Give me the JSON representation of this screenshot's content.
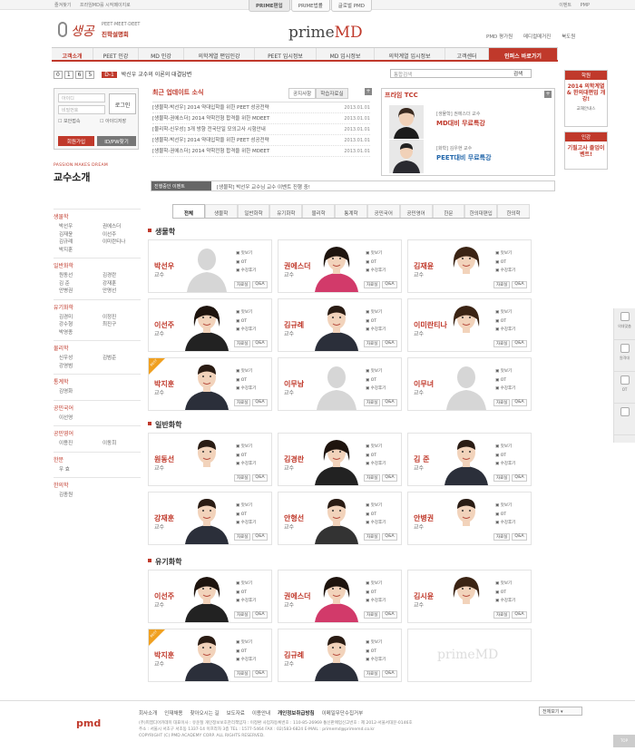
{
  "topbar": {
    "links": [
      "즐겨찾기",
      "프라임MD를 시작페이지로"
    ],
    "tabs": [
      "PRIME편입",
      "PRIME법률",
      "글로벌 PMD"
    ],
    "right": [
      "이벤트",
      "PMP"
    ]
  },
  "header": {
    "logo_left_text": "생공",
    "logo_left_sub": "PEET·MEET·DEET",
    "logo_left_sub2": "진학설명회",
    "brand_prefix": "prime",
    "brand_suffix": "MD",
    "links": [
      "PMD 평가원",
      "메디컬매거진",
      "북도원"
    ]
  },
  "nav": [
    "고객소개",
    "PEET 인강",
    "MD 인강",
    "의학계열 편입인강",
    "PEET 입시정보",
    "MD 입시정보",
    "의학계열 입시정보",
    "고객센터",
    "인퍼스 바로가기"
  ],
  "pagenav": {
    "digits": [
      "0",
      "1",
      "6",
      "5"
    ],
    "badge": "D-1",
    "text": "박신우 교수의 이론의 대결답변"
  },
  "search": {
    "placeholder": "통합검색",
    "button": "검색"
  },
  "login": {
    "id_placeholder": "아이디",
    "pw_placeholder": "비밀번호",
    "login_button": "로그인",
    "check1": "보안접속",
    "check2": "아이디저장",
    "join_button": "회원가입",
    "find_button": "ID/PW찾기"
  },
  "updates": {
    "title": "최근 업데이트 소식",
    "tab1": "공지사항",
    "tab2": "학습자료실",
    "plus": "+",
    "items": [
      {
        "text": "[생물학-박선우] 2014 약대입학을 위한 PEET 성공전략",
        "date": "2013.01.01"
      },
      {
        "text": "[생물학-권에스더] 2014 약학전형 합격을 위한 MDEET",
        "date": "2013.01.01"
      },
      {
        "text": "[물리학-신우성] 3개 방향 전국단일 모의고사 시험안내",
        "date": "2013.01.01"
      },
      {
        "text": "[생물학-박선우] 2014 약대입학을 위한 PEET 성공전략",
        "date": "2013.01.01"
      },
      {
        "text": "[생물학-권에스더] 2014 약학전형 합격을 위한 MDEET",
        "date": "2013.01.01"
      }
    ]
  },
  "tcc": {
    "title": "프라임 TCC",
    "plus": "+",
    "rows": [
      {
        "small": "[생물학] 권에스더 교수",
        "big": "MD대비 무료특강"
      },
      {
        "small": "[화학] 김우현 교수",
        "big": "PEET대비 무료특강"
      }
    ]
  },
  "ticker": {
    "label": "진행중인 이벤트",
    "text": "[생물학] 박선우 교수님 교수 이벤트 진행 중!"
  },
  "page": {
    "passion": "PASSION MAKES DREAM",
    "title": "교수소개"
  },
  "sidebar": [
    {
      "heading": "생물학",
      "items": [
        "박선우",
        "권에스더",
        "김재윤",
        "이선주",
        "김규례",
        "이미란티나",
        "박지훈",
        ""
      ]
    },
    {
      "heading": "일반화학",
      "items": [
        "원동선",
        "김경란",
        "김 준",
        "강재훈",
        "안병권",
        "안명선"
      ]
    },
    {
      "heading": "유기화학",
      "items": [
        "김경미",
        "이정진",
        "강수형",
        "최진구",
        "박영종",
        ""
      ]
    },
    {
      "heading": "물리학",
      "items": [
        "신우성",
        "김범준",
        "강영범",
        ""
      ]
    },
    {
      "heading": "통계학",
      "items": [
        "김영화",
        ""
      ]
    },
    {
      "heading": "공민국어",
      "items": [
        "이선영",
        ""
      ]
    },
    {
      "heading": "공민영어",
      "items": [
        "이용진",
        "이동희"
      ]
    },
    {
      "heading": "한문",
      "items": [
        "우 효",
        ""
      ]
    },
    {
      "heading": "한의학",
      "items": [
        "김종원",
        ""
      ]
    }
  ],
  "subtabs": [
    "전체",
    "생물학",
    "일반화학",
    "유기화학",
    "물리학",
    "통계학",
    "공민국어",
    "공민영어",
    "한문",
    "한의대편입",
    "한의학"
  ],
  "card_links": [
    "맛보기",
    "OT",
    "수강후기"
  ],
  "card_buttons": [
    "자료실",
    "Q&A"
  ],
  "ribbon_text": "BEST",
  "logo_card": {
    "prefix": "prime",
    "suffix": "MD"
  },
  "sections": [
    {
      "heading": "생물학",
      "cards": [
        {
          "name": "박선우",
          "role": "교수",
          "photo": "silhouette",
          "ribbon": false
        },
        {
          "name": "권에스더",
          "role": "교수",
          "photo": "woman",
          "ribbon": false
        },
        {
          "name": "김재윤",
          "role": "교수",
          "photo": "woman2",
          "ribbon": false
        },
        {
          "name": "이선주",
          "role": "교수",
          "photo": "woman3",
          "ribbon": false
        },
        {
          "name": "김규례",
          "role": "교수",
          "photo": "man",
          "ribbon": false
        },
        {
          "name": "이미란티나",
          "role": "교수",
          "photo": "woman2",
          "ribbon": false
        },
        {
          "name": "박지훈",
          "role": "교수",
          "photo": "man2",
          "ribbon": true
        },
        {
          "name": "이무남",
          "role": "교수",
          "photo": "silhouette",
          "ribbon": false
        },
        {
          "name": "이무녀",
          "role": "교수",
          "photo": "silhouette",
          "ribbon": false
        }
      ]
    },
    {
      "heading": "일반화학",
      "cards": [
        {
          "name": "원동선",
          "role": "교수",
          "photo": "man3",
          "ribbon": false
        },
        {
          "name": "김경란",
          "role": "교수",
          "photo": "woman3",
          "ribbon": false
        },
        {
          "name": "김 준",
          "role": "교수",
          "photo": "man",
          "ribbon": false
        },
        {
          "name": "강재훈",
          "role": "교수",
          "photo": "man2",
          "ribbon": false
        },
        {
          "name": "안형선",
          "role": "교수",
          "photo": "man4",
          "ribbon": false
        },
        {
          "name": "안병권",
          "role": "교수",
          "photo": "man3",
          "ribbon": false
        }
      ]
    },
    {
      "heading": "유기화학",
      "cards": [
        {
          "name": "이선주",
          "role": "교수",
          "photo": "woman3",
          "ribbon": false
        },
        {
          "name": "권에스더",
          "role": "교수",
          "photo": "woman",
          "ribbon": false
        },
        {
          "name": "김시윤",
          "role": "교수",
          "photo": "woman2",
          "ribbon": false
        },
        {
          "name": "박지훈",
          "role": "교수",
          "photo": "man2",
          "ribbon": true
        },
        {
          "name": "김규례",
          "role": "교수",
          "photo": "man",
          "ribbon": false
        },
        {
          "name": "",
          "role": "",
          "photo": "logo",
          "ribbon": false
        }
      ]
    }
  ],
  "right_banner1": {
    "tag": "학원",
    "main": "2014 의학계열 & 한의대편입 개강!",
    "sub": "교재안내스"
  },
  "right_banner2": {
    "tag": "인강",
    "main": "기필고사 졸업이벤트!"
  },
  "floating": [
    "의대맞춤",
    "원격대",
    "OT",
    "TOP"
  ],
  "footer": {
    "logo": "pmd",
    "links": [
      "회사소개",
      "인재채용",
      "찾아오시는 길",
      "보도자료",
      "이용안내",
      "개인정보취급방침",
      "이메일무단수집거부"
    ],
    "bold_link_index": 5,
    "info": [
      "(주)피엠디아카데미 대표이사 : 유운철  개인정보보호관리책임자 : 이정환  사업자등록번호 : 110-85-26969  통신판매업신고번호 : 제 2012-서울서대문-0146호",
      "주소 : 서울시 서초구 서초동 1337-14 이프라자 3층  TEL : 1577-5464  FAX : 02)583-6824  E-MAIL : primemd@primemd.co.kr",
      "COPYRIGHT (C) PMD ACADEMY CORP. ALL RIGHTS RESERVED."
    ],
    "select": "전체보기"
  }
}
